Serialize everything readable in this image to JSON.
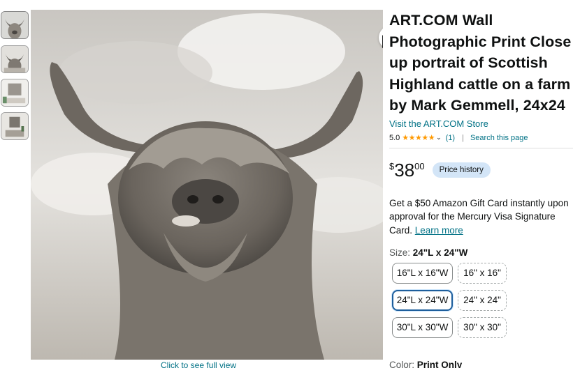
{
  "product": {
    "title": "ART.COM Wall Photographic Print Close up portrait of Scottish Highland cattle on a farm by Mark Gemmell, 24x24",
    "store_link": "Visit the ART.COM Store",
    "rating": {
      "value": "5.0",
      "stars": "★★★★★",
      "chevron": "⌄",
      "count": "(1)",
      "separator": "|",
      "search_page": "Search this page"
    },
    "price": {
      "currency": "$",
      "dollars": "38",
      "cents": "00",
      "history_label": "Price history"
    },
    "promo": {
      "text": "Get a $50 Amazon Gift Card instantly upon approval for the Mercury Visa Signature Card. ",
      "link": "Learn more"
    },
    "size": {
      "label": "Size: ",
      "selected": "24\"L x 24\"W",
      "options": [
        {
          "label": "16\"L x 16\"W"
        },
        {
          "label": "16\" x 16\""
        },
        {
          "label": "24\"L x 24\"W"
        },
        {
          "label": "24\" x 24\""
        },
        {
          "label": "30\"L x 30\"W"
        },
        {
          "label": "30\" x 30\""
        }
      ]
    },
    "color": {
      "label": "Color: ",
      "value": "Print Only"
    }
  },
  "gallery": {
    "click_full": "Click to see full view",
    "share_icon": "share-icon",
    "thumbnails": [
      {
        "name": "thumbnail-cattle-portrait"
      },
      {
        "name": "thumbnail-cattle-portrait-alt"
      },
      {
        "name": "thumbnail-room-scene"
      },
      {
        "name": "thumbnail-room-scene-alt"
      }
    ]
  },
  "colors": {
    "link": "#007185",
    "star": "#ff9900",
    "price_history_bg": "#d3e5f7",
    "selected_border": "#1d5e9c"
  }
}
